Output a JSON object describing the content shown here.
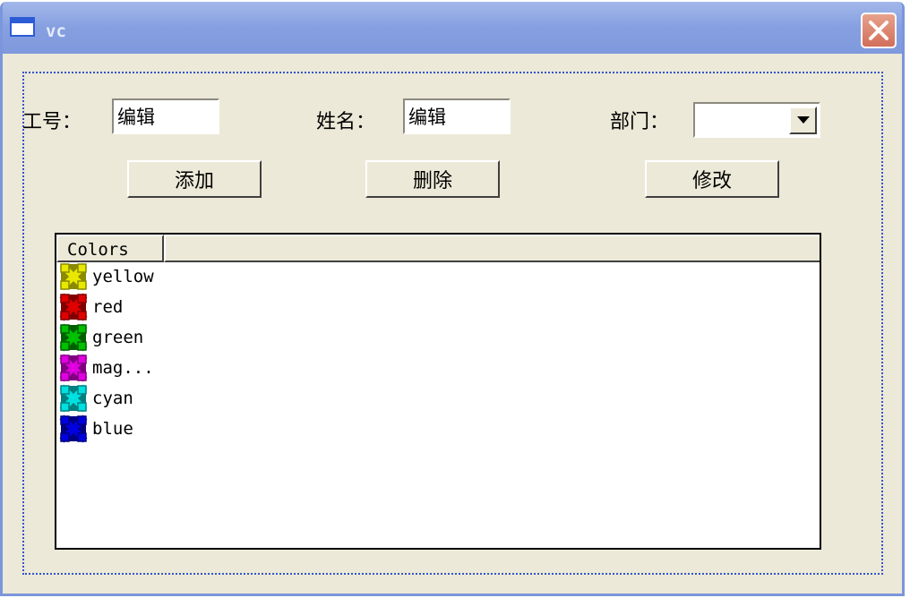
{
  "window": {
    "title": "vc"
  },
  "form": {
    "id_label": "工号：",
    "id_value": "编辑",
    "name_label": "姓名：",
    "name_value": "编辑",
    "dept_label": "部门：",
    "dept_value": ""
  },
  "buttons": {
    "add": "添加",
    "delete": "删除",
    "modify": "修改"
  },
  "list": {
    "columns": [
      "Colors",
      ""
    ],
    "items": [
      {
        "label": "yellow",
        "color": "#E8E800",
        "dark": "#8A8A00"
      },
      {
        "label": "red",
        "color": "#E00000",
        "dark": "#800000"
      },
      {
        "label": "green",
        "color": "#00C000",
        "dark": "#006000"
      },
      {
        "label": "mag...",
        "color": "#E000E0",
        "dark": "#800080"
      },
      {
        "label": "cyan",
        "color": "#00E0E0",
        "dark": "#008080"
      },
      {
        "label": "blue",
        "color": "#0000E0",
        "dark": "#000080"
      }
    ]
  },
  "colors": {
    "titlebar": "#859FE0",
    "face": "#ECE9D8",
    "close": "#D26E5A"
  }
}
